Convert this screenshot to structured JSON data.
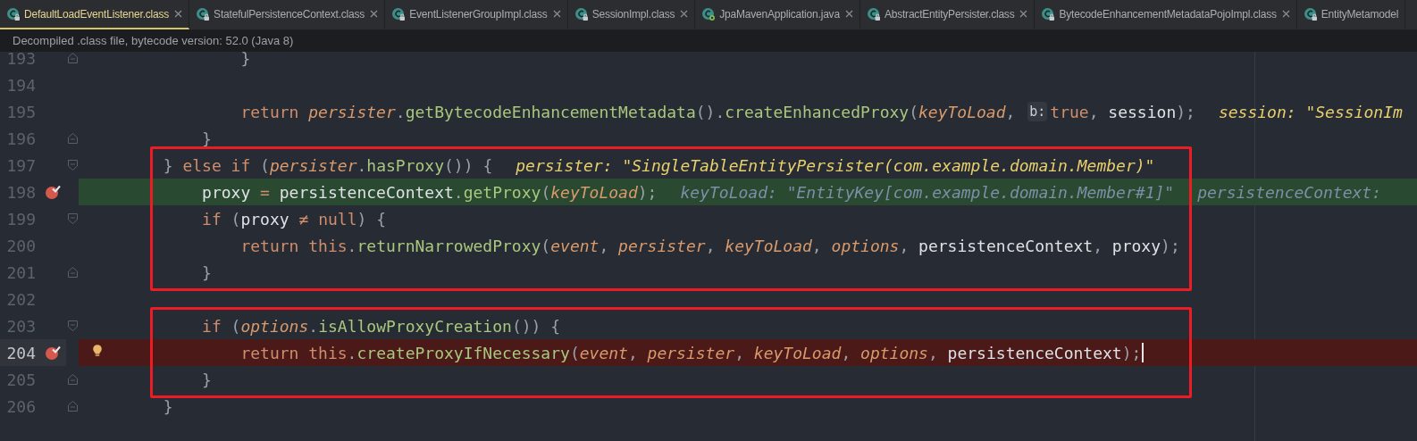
{
  "tabs": [
    {
      "label": "DefaultLoadEventListener.class",
      "kind": "class",
      "selected": true
    },
    {
      "label": "StatefulPersistenceContext.class",
      "kind": "class",
      "selected": false
    },
    {
      "label": "EventListenerGroupImpl.class",
      "kind": "class",
      "selected": false
    },
    {
      "label": "SessionImpl.class",
      "kind": "class",
      "selected": false
    },
    {
      "label": "JpaMavenApplication.java",
      "kind": "java",
      "selected": false
    },
    {
      "label": "AbstractEntityPersister.class",
      "kind": "class",
      "selected": false
    },
    {
      "label": "BytecodeEnhancementMetadataPojoImpl.class",
      "kind": "class",
      "selected": false
    },
    {
      "label": "EntityMetamodel",
      "kind": "class",
      "selected": false,
      "closable": false
    }
  ],
  "notice": "Decompiled .class file, bytecode version: 52.0 (Java 8)",
  "editor": {
    "blocks": [
      {
        "lines": [
          {
            "number": "193",
            "kind": "plain",
            "fold": {
              "kind": "end"
            },
            "tokens": [
              {
                "kind": "punct",
                "text": "                }"
              }
            ]
          },
          {
            "number": "194",
            "kind": "plain"
          },
          {
            "number": "195",
            "kind": "plain",
            "tokens": [
              {
                "kind": "keyword",
                "text": "                return"
              },
              {
                "kind": "param",
                "text": " persister"
              },
              {
                "kind": "punct",
                "text": "."
              },
              {
                "kind": "method",
                "text": "getBytecodeEnhancementMetadata"
              },
              {
                "kind": "punct",
                "text": "()."
              },
              {
                "kind": "method",
                "text": "createEnhancedProxy"
              },
              {
                "kind": "punct",
                "text": "("
              },
              {
                "kind": "param",
                "text": "keyToLoad"
              },
              {
                "kind": "punct",
                "text": ", "
              },
              {
                "kind": "inlay",
                "text": "b:"
              },
              {
                "kind": "keyword",
                "text": "true"
              },
              {
                "kind": "punct",
                "text": ", "
              },
              {
                "kind": "plain",
                "text": "session"
              },
              {
                "kind": "punct",
                "text": ");"
              },
              {
                "kind": "hint",
                "text": "session: \"SessionIm"
              }
            ]
          },
          {
            "number": "196",
            "kind": "plain",
            "fold": {
              "kind": "end"
            },
            "tokens": [
              {
                "kind": "punct",
                "text": "            }"
              }
            ]
          }
        ]
      },
      {
        "framed": true,
        "lines": [
          {
            "number": "197",
            "kind": "plain",
            "fold": {
              "kind": "start"
            },
            "tokens": [
              {
                "kind": "punct",
                "text": "        } "
              },
              {
                "kind": "keyword",
                "text": "else if"
              },
              {
                "kind": "punct",
                "text": " ("
              },
              {
                "kind": "param",
                "text": "persister"
              },
              {
                "kind": "punct",
                "text": "."
              },
              {
                "kind": "method",
                "text": "hasProxy"
              },
              {
                "kind": "punct",
                "text": "()) {"
              },
              {
                "kind": "hint",
                "text": "persister: \"SingleTableEntityPersister(com.example.domain.Member)\""
              }
            ]
          },
          {
            "number": "198",
            "kind": "execution",
            "breakpoint": true,
            "tokens": [
              {
                "kind": "plain",
                "text": "            proxy"
              },
              {
                "kind": "operator",
                "text": " = "
              },
              {
                "kind": "plain",
                "text": "persistenceContext"
              },
              {
                "kind": "punct",
                "text": "."
              },
              {
                "kind": "method",
                "text": "getProxy"
              },
              {
                "kind": "punct",
                "text": "("
              },
              {
                "kind": "param",
                "text": "keyToLoad"
              },
              {
                "kind": "punct",
                "text": ");"
              },
              {
                "kind": "debug",
                "text": "keyToLoad: \"EntityKey[com.example.domain.Member#1]\""
              },
              {
                "kind": "debug",
                "text": "persistenceContext:"
              }
            ]
          },
          {
            "number": "199",
            "kind": "plain",
            "fold": {
              "kind": "start"
            },
            "tokens": [
              {
                "kind": "keyword",
                "text": "            if"
              },
              {
                "kind": "punct",
                "text": " ("
              },
              {
                "kind": "plain",
                "text": "proxy"
              },
              {
                "kind": "operator",
                "text": " ≠ "
              },
              {
                "kind": "keyword",
                "text": "null"
              },
              {
                "kind": "punct",
                "text": ") {"
              }
            ]
          },
          {
            "number": "200",
            "kind": "plain",
            "tokens": [
              {
                "kind": "keyword",
                "text": "                return this"
              },
              {
                "kind": "punct",
                "text": "."
              },
              {
                "kind": "method",
                "text": "returnNarrowedProxy"
              },
              {
                "kind": "punct",
                "text": "("
              },
              {
                "kind": "param",
                "text": "event"
              },
              {
                "kind": "punct",
                "text": ", "
              },
              {
                "kind": "param",
                "text": "persister"
              },
              {
                "kind": "punct",
                "text": ", "
              },
              {
                "kind": "param",
                "text": "keyToLoad"
              },
              {
                "kind": "punct",
                "text": ", "
              },
              {
                "kind": "param",
                "text": "options"
              },
              {
                "kind": "punct",
                "text": ", "
              },
              {
                "kind": "plain",
                "text": "persistenceContext"
              },
              {
                "kind": "punct",
                "text": ", "
              },
              {
                "kind": "plain",
                "text": "proxy"
              },
              {
                "kind": "punct",
                "text": ");"
              }
            ]
          },
          {
            "number": "201",
            "kind": "plain",
            "fold": {
              "kind": "end"
            },
            "tokens": [
              {
                "kind": "punct",
                "text": "            }"
              }
            ]
          }
        ]
      },
      {
        "lines": [
          {
            "number": "202",
            "kind": "plain"
          }
        ]
      },
      {
        "framed": true,
        "lines": [
          {
            "number": "203",
            "kind": "plain",
            "fold": {
              "kind": "start"
            },
            "tokens": [
              {
                "kind": "keyword",
                "text": "            if"
              },
              {
                "kind": "punct",
                "text": " ("
              },
              {
                "kind": "param",
                "text": "options"
              },
              {
                "kind": "punct",
                "text": "."
              },
              {
                "kind": "method",
                "text": "isAllowProxyCreation"
              },
              {
                "kind": "punct",
                "text": "()) {"
              }
            ]
          },
          {
            "number": "204",
            "kind": "breakpoint",
            "breakpoint": true,
            "bulb": true,
            "cursor": true,
            "tokens": [
              {
                "kind": "keyword",
                "text": "                return this"
              },
              {
                "kind": "punct",
                "text": "."
              },
              {
                "kind": "method",
                "text": "createProxyIfNecessary"
              },
              {
                "kind": "punct",
                "text": "("
              },
              {
                "kind": "param",
                "text": "event"
              },
              {
                "kind": "punct",
                "text": ", "
              },
              {
                "kind": "param",
                "text": "persister"
              },
              {
                "kind": "punct",
                "text": ", "
              },
              {
                "kind": "param",
                "text": "keyToLoad"
              },
              {
                "kind": "punct",
                "text": ", "
              },
              {
                "kind": "param",
                "text": "options"
              },
              {
                "kind": "punct",
                "text": ", "
              },
              {
                "kind": "plain",
                "text": "persistenceContext"
              },
              {
                "kind": "punct",
                "text": ");"
              }
            ]
          },
          {
            "number": "205",
            "kind": "plain",
            "fold": {
              "kind": "end"
            },
            "tokens": [
              {
                "kind": "punct",
                "text": "            }"
              }
            ]
          }
        ]
      },
      {
        "lines": [
          {
            "number": "206",
            "kind": "plain",
            "fold": {
              "kind": "end"
            },
            "tokens": [
              {
                "kind": "punct",
                "text": "        }"
              }
            ]
          }
        ]
      }
    ]
  }
}
